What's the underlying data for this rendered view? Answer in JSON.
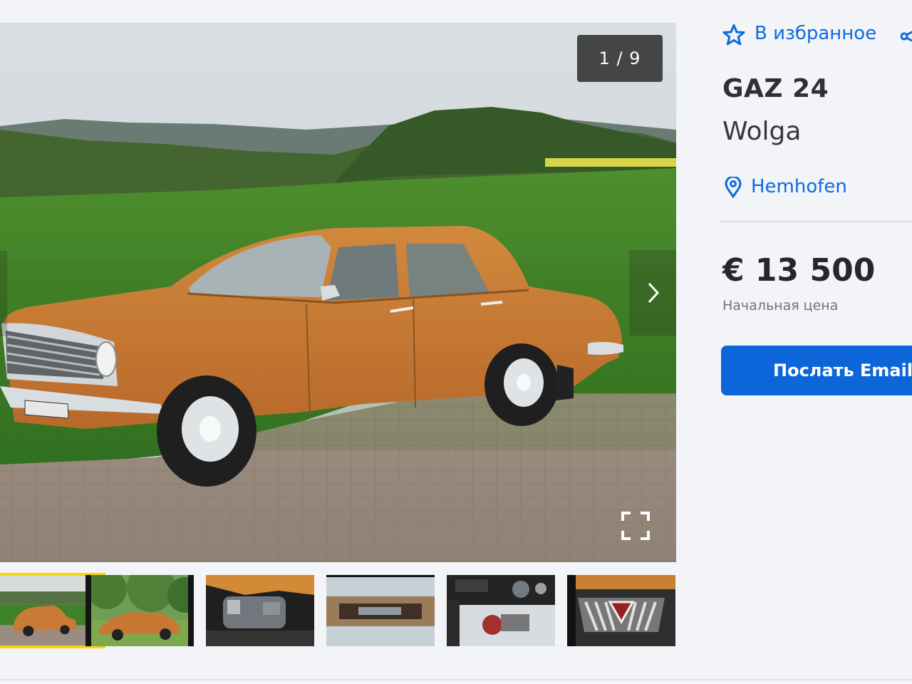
{
  "gallery": {
    "counter": "1 / 9",
    "total_images": 9,
    "current_image": 1,
    "thumbnails": [
      {
        "name": "thumb-side-view",
        "active": true
      },
      {
        "name": "thumb-tree-side-view",
        "active": false
      },
      {
        "name": "thumb-engine-bay",
        "active": false
      },
      {
        "name": "thumb-dash-panel",
        "active": false
      },
      {
        "name": "thumb-interior",
        "active": false
      },
      {
        "name": "thumb-grille",
        "active": false
      }
    ]
  },
  "actions": {
    "favorite_label": "В избранное"
  },
  "listing": {
    "make_model": "GAZ 24",
    "name": "Wolga",
    "location": "Hemhofen",
    "price": "€ 13 500",
    "price_note": "Начальная цена",
    "email_button_label": "Послать Email"
  },
  "colors": {
    "accent_blue": "#0d66d9",
    "car_orange": "#c57d35",
    "thumbnail_active_border": "#f5d611",
    "text_dark": "#2e3035",
    "text_muted": "#6f737b",
    "divider": "#d9dde4",
    "page_background": "#f3f4f7"
  },
  "icons": {
    "favorite": "star-icon",
    "share": "share-icon",
    "location": "map-pin-icon",
    "previous": "chevron-left-icon",
    "next": "chevron-right-icon",
    "fullscreen": "fullscreen-icon"
  }
}
